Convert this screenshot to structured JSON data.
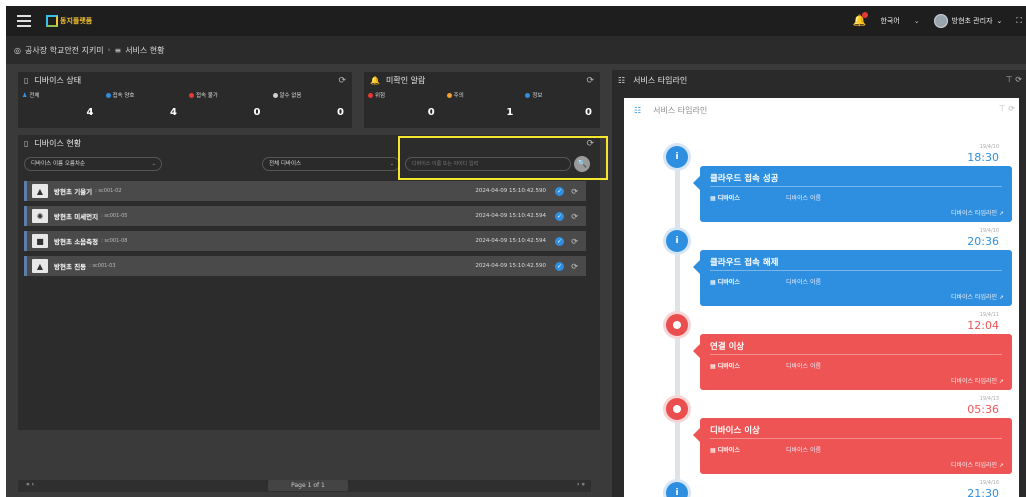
{
  "topbar": {
    "logo_text": "동지플랫폼",
    "language": "한국어",
    "user_name": "방현초 관리자",
    "user_chevron": "⌄"
  },
  "breadcrumb": {
    "site": "공사장 학교안전 지키미",
    "page": "서비스 현황"
  },
  "device_status": {
    "title": "디바이스 상태",
    "stats": [
      {
        "label": "전체",
        "value": "4",
        "color": "#3d8fe0"
      },
      {
        "label": "접속 양호",
        "value": "4",
        "color": "#2e8fe0"
      },
      {
        "label": "접속 불가",
        "value": "0",
        "color": "#e53935"
      },
      {
        "label": "알수 없음",
        "value": "0",
        "color": "#cfcfcf"
      }
    ]
  },
  "alerts": {
    "title": "미확인 알람",
    "stats": [
      {
        "label": "위험",
        "value": "0",
        "color": "#e53935"
      },
      {
        "label": "주의",
        "value": "1",
        "color": "#f2a12f"
      },
      {
        "label": "정보",
        "value": "0",
        "color": "#2e8fe0"
      }
    ]
  },
  "device_list": {
    "title": "디바이스 현황",
    "sort_select": "디바이스 이름 오름차순",
    "type_select": "전체 디바이스",
    "search_placeholder": "디바이스 이름 또는 아이디 입력",
    "items": [
      {
        "name": "방현초 기울기",
        "id": ": sc001-02",
        "time": "2024-04-09 15:10:42.590",
        "icon": "tilt-sensor-icon"
      },
      {
        "name": "방현초 미세먼지",
        "id": ": sc001-05",
        "time": "2024-04-09 15:10:42.594",
        "icon": "dust-sensor-icon"
      },
      {
        "name": "방현초 소음측정",
        "id": ": sc001-08",
        "time": "2024-04-09 15:10:42.594",
        "icon": "noise-sensor-icon"
      },
      {
        "name": "방현초 진동",
        "id": ": sc001-03",
        "time": "2024-04-09 15:10:42.590",
        "icon": "vibration-sensor-icon"
      }
    ],
    "pager": {
      "first_prev": "« ‹",
      "page_text": "Page 1 of 1",
      "next_last": "› »"
    }
  },
  "timeline": {
    "outer_title": "서비스 타임라인",
    "inner_title": "서비스 타임라인",
    "events": [
      {
        "title": "클라우드 접속 성공",
        "date": "19/4/10",
        "time": "18:30",
        "tag": "디바이스",
        "device": "디바이스 이름",
        "link": "디바이스 타임라인 ➚",
        "kind": "info",
        "color": "#2e8fe0"
      },
      {
        "title": "클라우드 접속 해제",
        "date": "19/4/10",
        "time": "20:36",
        "tag": "디바이스",
        "device": "디바이스 이름",
        "link": "디바이스 타임라인 ➚",
        "kind": "info",
        "color": "#2e8fe0"
      },
      {
        "title": "연결 이상",
        "date": "19/4/11",
        "time": "12:04",
        "tag": "디바이스",
        "device": "디바이스 이름",
        "link": "디바이스 타임라인 ➚",
        "kind": "error",
        "color": "#ee5454"
      },
      {
        "title": "디바이스 이상",
        "date": "19/4/13",
        "time": "05:36",
        "tag": "디바이스",
        "device": "디바이스 이름",
        "link": "디바이스 타임라인 ➚",
        "kind": "error",
        "color": "#ee5454"
      },
      {
        "title": "",
        "date": "19/4/16",
        "time": "21:30",
        "tag": "",
        "device": "",
        "link": "",
        "kind": "info",
        "color": "#2e8fe0"
      }
    ]
  }
}
